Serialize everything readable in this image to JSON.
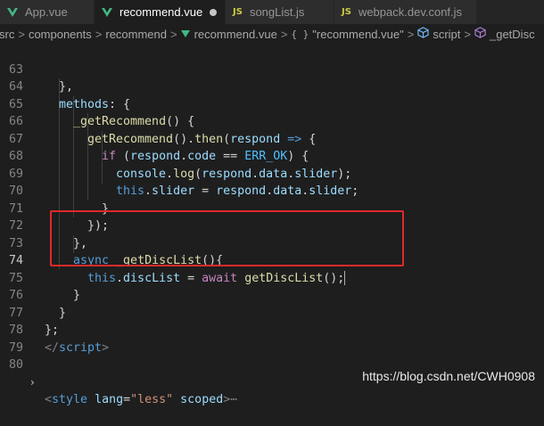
{
  "tabs": [
    {
      "label": "App.vue",
      "icon": "vue-icon"
    },
    {
      "label": "recommend.vue",
      "icon": "vue-icon",
      "active": true,
      "dirty": true
    },
    {
      "label": "songList.js",
      "icon": "js-icon"
    },
    {
      "label": "webpack.dev.conf.js",
      "icon": "js-icon"
    }
  ],
  "js_icon_label": "JS",
  "breadcrumb": {
    "items": [
      "src",
      "components",
      "recommend",
      "recommend.vue",
      "\"recommend.vue\"",
      "script",
      "_getDisc"
    ],
    "separator": ">"
  },
  "line_numbers": [
    "63",
    "64",
    "65",
    "66",
    "67",
    "68",
    "69",
    "70",
    "71",
    "72",
    "73",
    "74",
    "75",
    "76",
    "77",
    "78",
    "79",
    "80"
  ],
  "current_line": "74",
  "code": {
    "l63": "},",
    "l64_key": "methods",
    "l64_rest": ": {",
    "l65_fn": "_getRecommend",
    "l65_rest": "() {",
    "l66_fn": "getRecommend",
    "l66_mid": "().",
    "l66_fn2": "then",
    "l66_p": "(",
    "l66_var": "respond",
    "l66_arrow": "=>",
    "l66_end": "{",
    "l67_if": "if",
    "l67_p": "(",
    "l67_var": "respond",
    "l67_prop": "code",
    "l67_op": "==",
    "l67_const": "ERR_OK",
    "l67_end": ") {",
    "l68_obj": "console",
    "l68_fn": "log",
    "l68_args": "(respond.data.slider);",
    "l68_var": "respond",
    "l68_p1": "data",
    "l68_p2": "slider",
    "l69_this": "this",
    "l69_prop": "slider",
    "l69_op": "=",
    "l69_var": "respond",
    "l69_p1": "data",
    "l69_p2": "slider",
    "l70": "}",
    "l71": "});",
    "l72": "},",
    "l73_async": "async",
    "l73_fn": "_getDiscList",
    "l73_rest": "(){",
    "l74_this": "this",
    "l74_prop": "discList",
    "l74_op": "=",
    "l74_await": "await",
    "l74_fn": "getDiscList",
    "l74_rest": "();",
    "l75": "}",
    "l76": "}",
    "l77": "};",
    "l78_open": "</",
    "l78_tag": "script",
    "l78_close": ">",
    "l80_chev": "›",
    "l80_lt": "<",
    "l80_tag": "style",
    "l80_attr": "lang",
    "l80_eq": "=",
    "l80_val": "\"less\"",
    "l80_attr2": "scoped",
    "l80_gt": ">",
    "l80_more": "⋯"
  },
  "watermark": "https://blog.csdn.net/CWH0908",
  "colors": {
    "highlight_box": "#e02a2a",
    "vue": "#41b883",
    "js": "#cbcb41"
  }
}
